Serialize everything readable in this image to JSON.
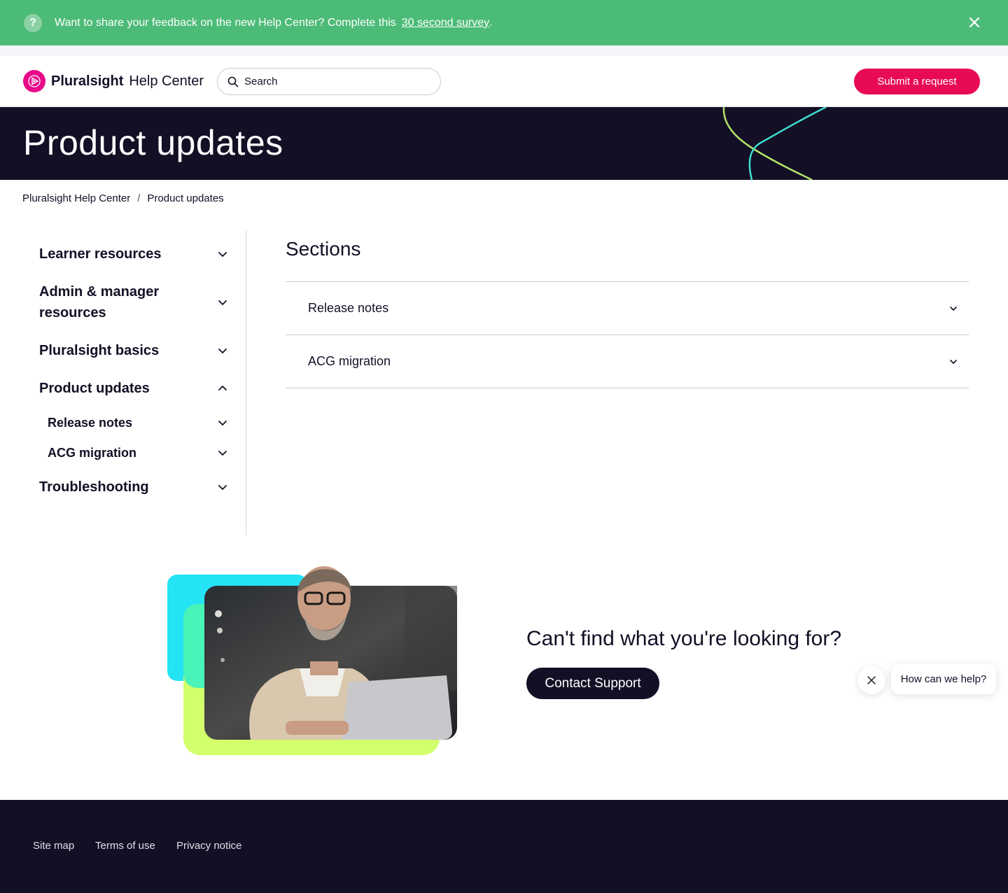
{
  "banner": {
    "message": "Want to share your feedback on the new Help Center? Complete this",
    "link_text": "30 second survey",
    "link_suffix": ".",
    "help_icon": "question-circle-icon",
    "close_icon": "close-icon",
    "background": "#4cbb77"
  },
  "header": {
    "brand": "Pluralsight",
    "brand_suffix": "Help Center",
    "logo_icon": "pluralsight-play-icon",
    "search_placeholder": "Search",
    "search_icon": "search-icon",
    "submit_label": "Submit a request",
    "accent": "#e80a55"
  },
  "hero": {
    "title": "Product updates",
    "background": "#130f25"
  },
  "breadcrumb": {
    "items": [
      "Pluralsight Help Center",
      "Product updates"
    ],
    "separator": "/"
  },
  "sidebar": {
    "items": [
      {
        "label": "Learner resources",
        "expanded": false
      },
      {
        "label": "Admin & manager resources",
        "expanded": false
      },
      {
        "label": "Pluralsight basics",
        "expanded": false
      },
      {
        "label": "Product updates",
        "expanded": true
      },
      {
        "label": "Release notes",
        "expanded": false,
        "sub": true
      },
      {
        "label": "ACG migration",
        "expanded": false,
        "sub": true
      },
      {
        "label": "Troubleshooting",
        "expanded": false
      }
    ]
  },
  "main": {
    "sections_title": "Sections",
    "sections": [
      {
        "label": "Release notes"
      },
      {
        "label": "ACG migration"
      }
    ]
  },
  "cta": {
    "title": "Can't find what you're looking for?",
    "button_label": "Contact Support",
    "image": "person-working-on-laptop-photo"
  },
  "chat": {
    "bubble_text": "How can we help?",
    "close_icon": "close-icon"
  },
  "footer": {
    "links": [
      "Site map",
      "Terms of use",
      "Privacy notice"
    ],
    "background": "#130f25"
  }
}
